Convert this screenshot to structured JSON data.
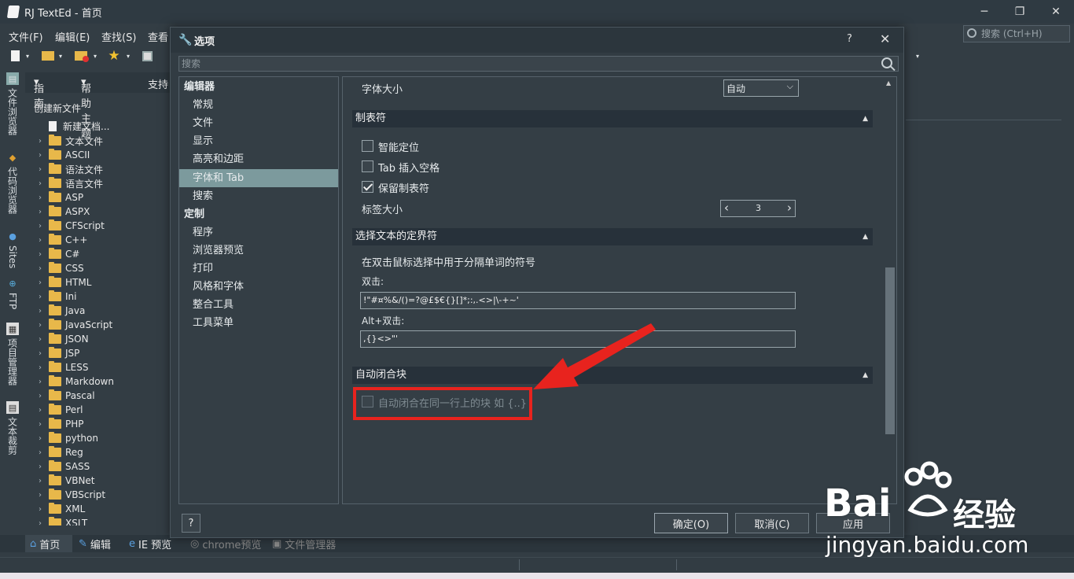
{
  "app": {
    "title": "RJ TextEd - 首页"
  },
  "menu": {
    "items": [
      "文件(F)",
      "编辑(E)",
      "查找(S)",
      "查看"
    ]
  },
  "search_main": {
    "placeholder": "搜索 (Ctrl+H)"
  },
  "vtabs": [
    "文件浏览器",
    "代码浏览器",
    "Sites",
    "FTP",
    "项目管理器",
    "文本裁剪"
  ],
  "guidebar": {
    "items": [
      "指南",
      "帮助主题",
      "支持"
    ]
  },
  "filetree": {
    "header": "创建新文件",
    "new_doc": "新建文档...",
    "items": [
      "文本文件",
      "ASCII",
      "语法文件",
      "语言文件",
      "ASP",
      "ASPX",
      "CFScript",
      "C++",
      "C#",
      "CSS",
      "HTML",
      "Ini",
      "Java",
      "JavaScript",
      "JSON",
      "JSP",
      "LESS",
      "Markdown",
      "Pascal",
      "Perl",
      "PHP",
      "python",
      "Reg",
      "SASS",
      "VBNet",
      "VBScript",
      "XML",
      "XSLT"
    ]
  },
  "bottomtabs": [
    "首页",
    "编辑",
    "IE 预览",
    "chrome预览",
    "文件管理器"
  ],
  "dialog": {
    "title": "选项",
    "help": "?",
    "search_placeholder": "搜索",
    "categories": [
      {
        "label": "编辑器",
        "header": true
      },
      {
        "label": "常规"
      },
      {
        "label": "文件"
      },
      {
        "label": "显示"
      },
      {
        "label": "高亮和边距"
      },
      {
        "label": "字体和 Tab",
        "selected": true
      },
      {
        "label": "搜索"
      },
      {
        "label": "定制",
        "header": true
      },
      {
        "label": "程序"
      },
      {
        "label": "浏览器预览"
      },
      {
        "label": "打印"
      },
      {
        "label": "风格和字体"
      },
      {
        "label": "整合工具"
      },
      {
        "label": "工具菜单"
      }
    ],
    "font_size_label": "字体大小",
    "font_size_value": "自动",
    "tab_section": "制表符",
    "smart_indent": "智能定位",
    "tab_insert_spaces": "Tab 插入空格",
    "keep_tabs": "保留制表符",
    "tab_size_label": "标签大小",
    "tab_size_value": "3",
    "delim_section": "选择文本的定界符",
    "delim_desc": "在双击鼠标选择中用于分隔单词的符号",
    "dblclick_label": "双击:",
    "dblclick_value": "!\"#¤%&/()=?@£$€{}[]*;:,.<>|\\-+~'",
    "altdbl_label": "Alt+双击:",
    "altdbl_value": ",{}<>\"'",
    "autoclose_section": "自动闭合块",
    "autoclose_option": "自动闭合在同一行上的块 如 {..}",
    "ok": "确定(O)",
    "cancel": "取消(C)",
    "apply": "应用",
    "bottom_help": "?"
  },
  "watermark": {
    "brand": "Bai",
    "brand2": "经验",
    "url": "jingyan.baidu.com"
  },
  "colors": {
    "annotation": "#e8231e",
    "selection": "#7c9a9d",
    "folder": "#e8b84a"
  }
}
